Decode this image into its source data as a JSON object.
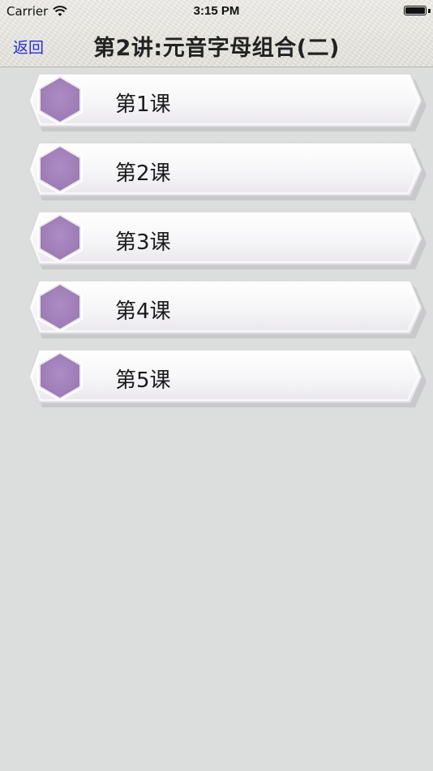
{
  "status_bar": {
    "carrier": "Carrier",
    "time": "3:15 PM",
    "battery_level": 1.0,
    "wifi_icon": "wifi-icon",
    "battery_icon": "battery-icon"
  },
  "nav": {
    "back_label": "返回",
    "title": "第2讲:元音字母组合(二)"
  },
  "colors": {
    "back_link": "#2a2bd4",
    "hexagon": "#a685bf",
    "background": "#dcdddd"
  },
  "lessons": [
    {
      "label": "第1课",
      "icon": "hexagon-icon"
    },
    {
      "label": "第2课",
      "icon": "hexagon-icon"
    },
    {
      "label": "第3课",
      "icon": "hexagon-icon"
    },
    {
      "label": "第4课",
      "icon": "hexagon-icon"
    },
    {
      "label": "第5课",
      "icon": "hexagon-icon"
    }
  ]
}
